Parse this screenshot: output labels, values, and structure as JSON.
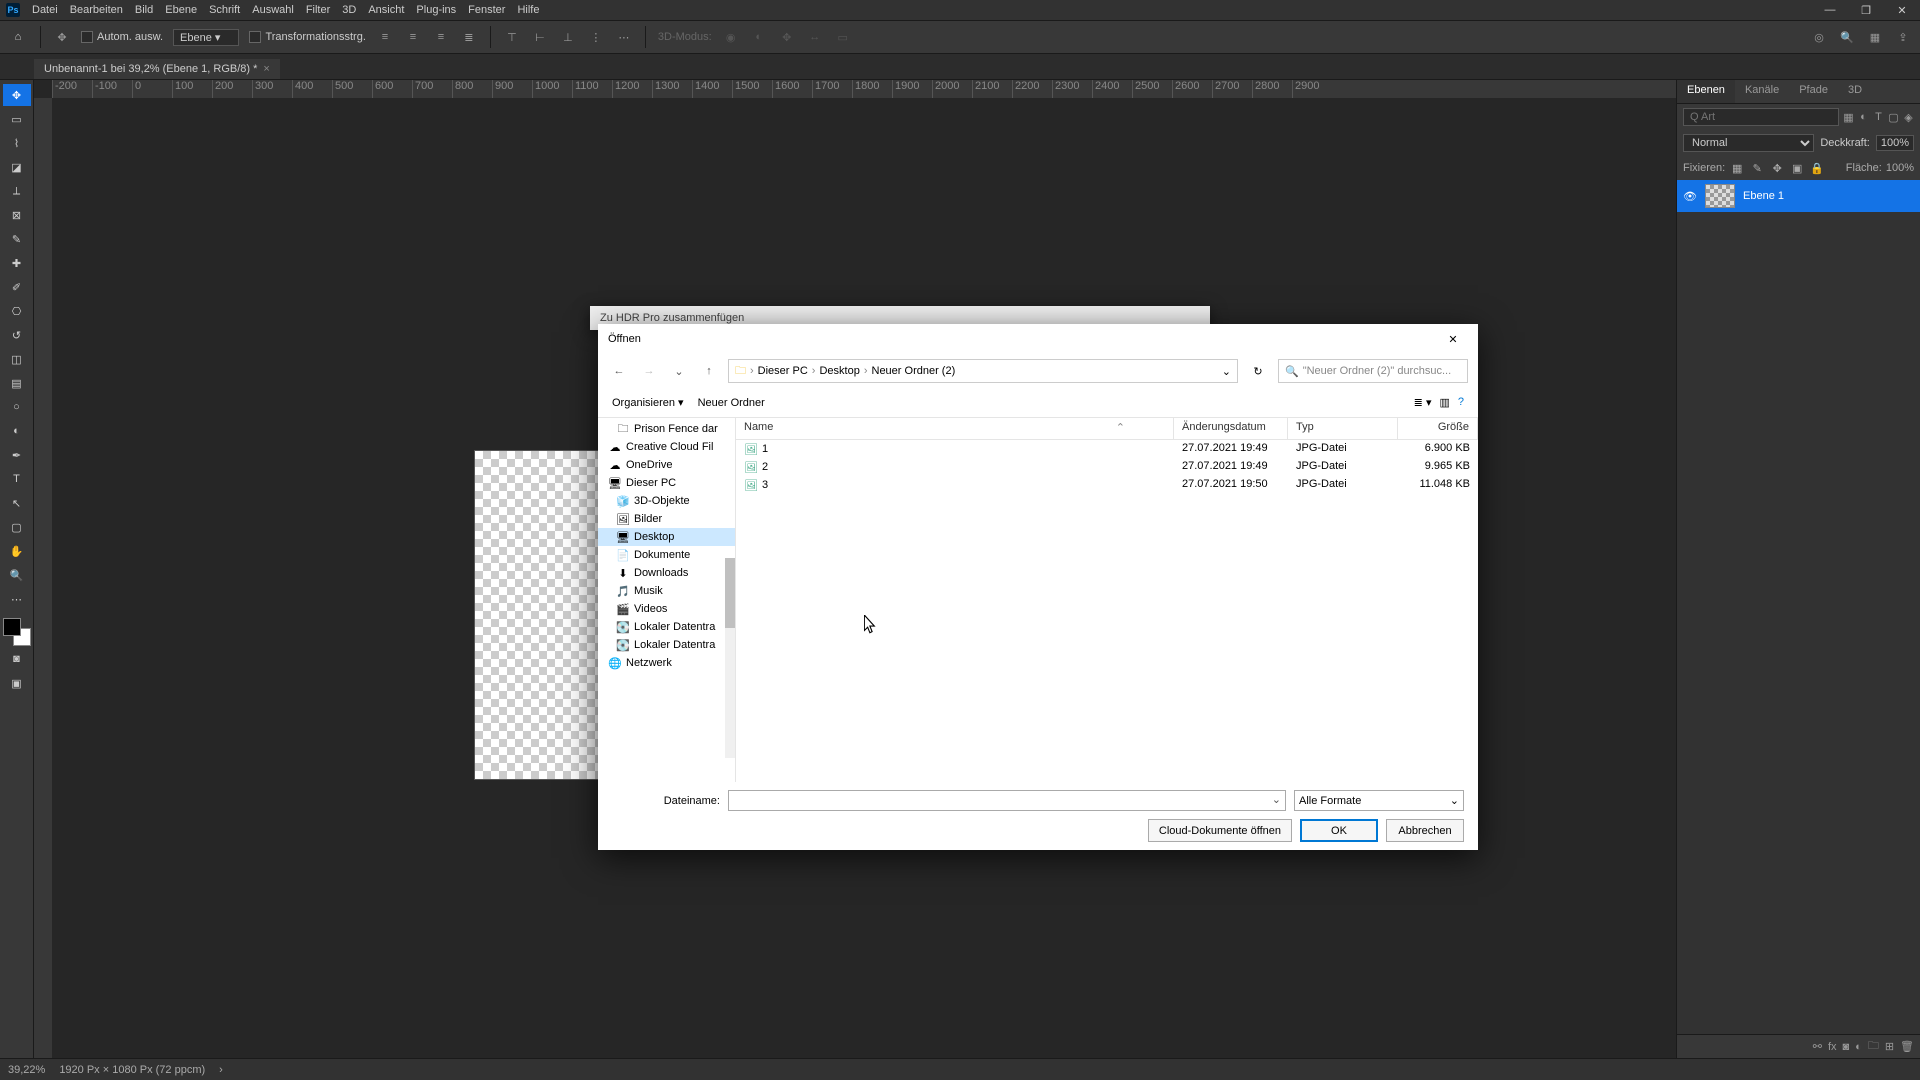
{
  "menubar": {
    "items": [
      "Datei",
      "Bearbeiten",
      "Bild",
      "Ebene",
      "Schrift",
      "Auswahl",
      "Filter",
      "3D",
      "Ansicht",
      "Plug-ins",
      "Fenster",
      "Hilfe"
    ]
  },
  "optionsbar": {
    "auto_select": "Autom. ausw.",
    "target": "Ebene",
    "transform": "Transformationsstrg.",
    "mode_3d": "3D-Modus:"
  },
  "doc_tab": {
    "title": "Unbenannt-1 bei 39,2% (Ebene 1, RGB/8) *"
  },
  "ruler_ticks": [
    "-200",
    "-100",
    "0",
    "100",
    "200",
    "300",
    "400",
    "500",
    "600",
    "700",
    "800",
    "900",
    "1000",
    "1100",
    "1200",
    "1300",
    "1400",
    "1500",
    "1600",
    "1700",
    "1800",
    "1900",
    "2000",
    "2100",
    "2200",
    "2300",
    "2400",
    "2500",
    "2600",
    "2700",
    "2800",
    "2900"
  ],
  "panels": {
    "tabs": [
      "Ebenen",
      "Kanäle",
      "Pfade",
      "3D"
    ],
    "search_placeholder": "Q Art",
    "blend_mode": "Normal",
    "opacity_label": "Deckkraft:",
    "opacity_value": "100%",
    "lock_label": "Fixieren:",
    "fill_label": "Fläche:",
    "fill_value": "100%",
    "layer_name": "Ebene 1"
  },
  "statusbar": {
    "zoom": "39,22%",
    "doc": "1920 Px × 1080 Px (72 ppcm)"
  },
  "hdr_dialog": {
    "title": "Zu HDR Pro zusammenfügen"
  },
  "open_dialog": {
    "title": "Öffnen",
    "breadcrumbs": [
      "Dieser PC",
      "Desktop",
      "Neuer Ordner (2)"
    ],
    "search_placeholder": "\"Neuer Ordner (2)\" durchsuc...",
    "organize": "Organisieren",
    "new_folder": "Neuer Ordner",
    "tree": [
      {
        "label": "Prison Fence dar",
        "icon": "folder",
        "indent": 18
      },
      {
        "label": "Creative Cloud Fil",
        "icon": "cloud",
        "indent": 10
      },
      {
        "label": "OneDrive",
        "icon": "onedrive",
        "indent": 10
      },
      {
        "label": "Dieser PC",
        "icon": "pc",
        "indent": 10
      },
      {
        "label": "3D-Objekte",
        "icon": "3d",
        "indent": 18
      },
      {
        "label": "Bilder",
        "icon": "pictures",
        "indent": 18
      },
      {
        "label": "Desktop",
        "icon": "desktop",
        "indent": 18,
        "selected": true
      },
      {
        "label": "Dokumente",
        "icon": "docs",
        "indent": 18
      },
      {
        "label": "Downloads",
        "icon": "downloads",
        "indent": 18
      },
      {
        "label": "Musik",
        "icon": "music",
        "indent": 18
      },
      {
        "label": "Videos",
        "icon": "videos",
        "indent": 18
      },
      {
        "label": "Lokaler Datentra",
        "icon": "drive",
        "indent": 18
      },
      {
        "label": "Lokaler Datentra",
        "icon": "drive",
        "indent": 18
      },
      {
        "label": "Netzwerk",
        "icon": "network",
        "indent": 10
      }
    ],
    "columns": {
      "name": "Name",
      "date": "Änderungsdatum",
      "type": "Typ",
      "size": "Größe"
    },
    "files": [
      {
        "name": "1",
        "date": "27.07.2021 19:49",
        "type": "JPG-Datei",
        "size": "6.900 KB"
      },
      {
        "name": "2",
        "date": "27.07.2021 19:49",
        "type": "JPG-Datei",
        "size": "9.965 KB"
      },
      {
        "name": "3",
        "date": "27.07.2021 19:50",
        "type": "JPG-Datei",
        "size": "11.048 KB"
      }
    ],
    "filename_label": "Dateiname:",
    "filetype": "Alle Formate",
    "cloud_btn": "Cloud-Dokumente öffnen",
    "ok_btn": "OK",
    "cancel_btn": "Abbrechen"
  }
}
